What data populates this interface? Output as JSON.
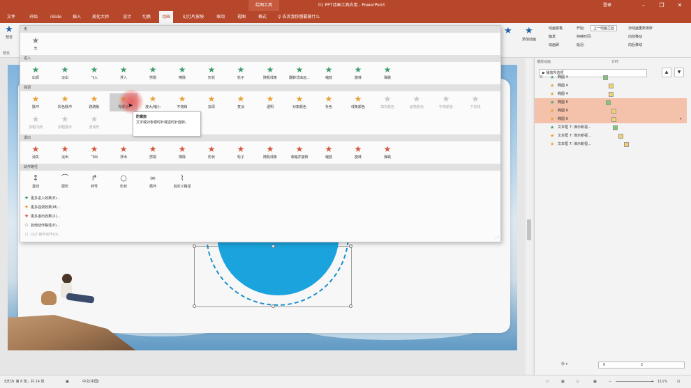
{
  "window": {
    "context_tab": "绘图工具",
    "document_title": "01 PPT动画工具应用 - PowerPoint",
    "login_label": "登录",
    "min_icon": "window-minimize-icon",
    "max_icon": "window-restore-icon",
    "close_icon": "window-close-icon"
  },
  "ribbon_tabs": [
    "文件",
    "开始",
    "iSlide",
    "插入",
    "美化大师",
    "设计",
    "切换",
    "动画",
    "幻灯片放映",
    "审阅",
    "视图",
    "格式"
  ],
  "active_tab": "动画",
  "tell_me": "告诉我你想要做什么",
  "ribbon": {
    "preview_label": "预览",
    "preview_group": "预览",
    "add_animation": "添加动画",
    "animation_pane": "动画窗格",
    "trigger": "触发",
    "animation_painter": "动画刷",
    "start_label": "开始:",
    "start_value": "上一动画之后",
    "duration_label": "持续时间:",
    "delay_label": "延迟:",
    "reorder": "对动画重新排序",
    "move_earlier": "向前移动",
    "move_later": "向后移动"
  },
  "gallery": {
    "sections": {
      "none": "无",
      "entrance": "进入",
      "emphasis": "强调",
      "exit": "退出",
      "motion": "动作路径"
    },
    "none_effects": [
      "无"
    ],
    "entrance_effects": [
      "出现",
      "淡出",
      "飞入",
      "浮入",
      "劈裂",
      "擦除",
      "形状",
      "轮子",
      "随机线条",
      "翻转式由远...",
      "缩放",
      "旋转",
      "弹跳"
    ],
    "emphasis_effects_row1": [
      "脉冲",
      "彩色脉冲",
      "跷跷板",
      "陀螺旋",
      "放大/缩小",
      "不饱和",
      "加深",
      "变淡",
      "透明",
      "对象颜色",
      "补色",
      "线条颜色",
      "填充颜色",
      "画笔颜色",
      "字体颜色",
      "下划线"
    ],
    "emphasis_effects_row2": [
      "加粗闪烁",
      "加粗展示",
      "波浪形"
    ],
    "exit_effects": [
      "消失",
      "淡出",
      "飞出",
      "浮出",
      "劈裂",
      "擦除",
      "形状",
      "轮子",
      "随机线条",
      "收缩并旋转",
      "缩放",
      "旋转",
      "弹跳"
    ],
    "motion_effects": [
      "直线",
      "弧形",
      "转弯",
      "形状",
      "循环",
      "自定义路径"
    ],
    "more_items": [
      {
        "icon": "star-icon",
        "label": "更多进入效果(E)..."
      },
      {
        "icon": "star-icon",
        "label": "更多强调效果(M)..."
      },
      {
        "icon": "star-icon",
        "label": "更多退出效果(X)..."
      },
      {
        "icon": "star-outline-icon",
        "label": "其他动作路径(P)..."
      },
      {
        "icon": "ole-icon",
        "label": "OLE 操作动作(O)..."
      }
    ],
    "tooltip_title": "陀螺旋",
    "tooltip_text": "文字或对象顺时针或逆时针旋转。"
  },
  "animation_pane": {
    "header": "播放动画",
    "timing_header": "计时",
    "play_button": "播放所选项",
    "items": [
      {
        "num": "0",
        "icon": "star-icon",
        "name": "椭圆 4",
        "selected": false,
        "bar_color": "#7dc870"
      },
      {
        "num": "",
        "icon": "star-icon",
        "name": "椭圆 4",
        "selected": false,
        "bar_color": "#f2d06b"
      },
      {
        "num": "",
        "icon": "star-icon",
        "name": "椭圆 4",
        "selected": false,
        "bar_color": "#f2d06b"
      },
      {
        "num": "",
        "icon": "star-icon",
        "name": "椭圆 6",
        "selected": true,
        "bar_color": "#7dc870"
      },
      {
        "num": "",
        "icon": "star-icon",
        "name": "椭圆 6",
        "selected": true,
        "bar_color": "#f2d06b"
      },
      {
        "num": "",
        "icon": "star-icon",
        "name": "椭圆 6",
        "selected": true,
        "bar_color": "#f2d06b"
      },
      {
        "num": "",
        "icon": "star-icon",
        "name": "文本框 7: 演示新视...",
        "selected": false,
        "bar_color": "#7dc870"
      },
      {
        "num": "",
        "icon": "star-icon",
        "name": "文本框 7: 演示新视...",
        "selected": false,
        "bar_color": "#f2d06b"
      },
      {
        "num": "",
        "icon": "star-icon",
        "name": "文本框 7: 演示新视...",
        "selected": false,
        "bar_color": "#f2d06b"
      }
    ],
    "seconds_label": "秒",
    "timeline_ticks": [
      "0",
      "2"
    ]
  },
  "status_bar": {
    "slide_info": "幻灯片 第 8 张，共 14 张",
    "language": "中文(中国)",
    "zoom": "111%"
  },
  "colors": {
    "accent": "#b7472a",
    "entrance": "#3f9b6e",
    "emphasis": "#e7a33b",
    "exit": "#d3553b",
    "pane_selected": "#f4c1ab"
  }
}
